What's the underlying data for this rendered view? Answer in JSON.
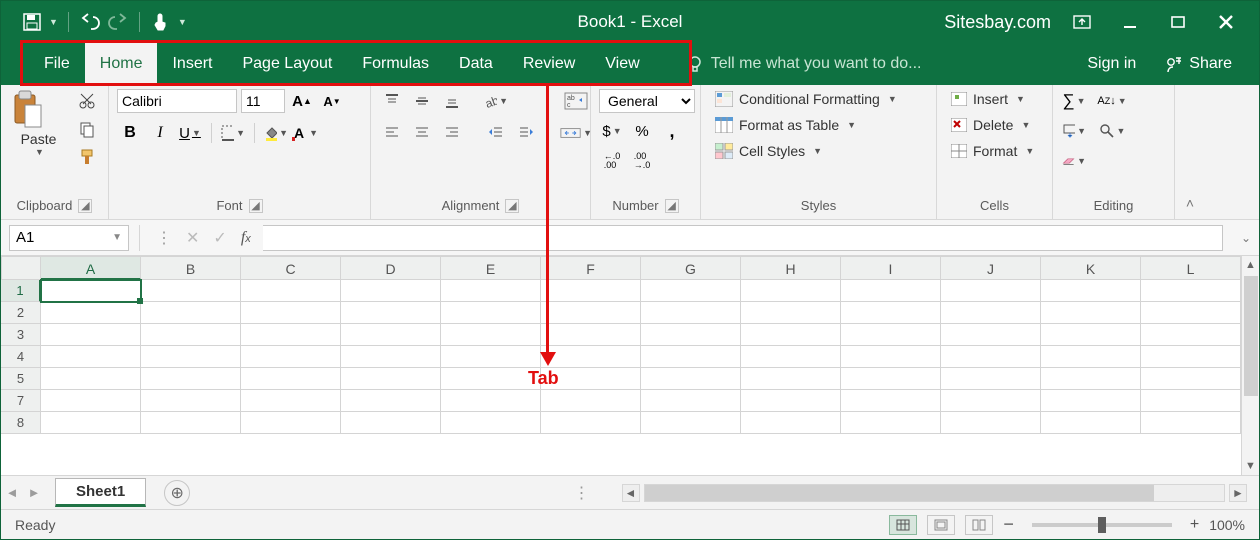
{
  "titlebar": {
    "title": "Book1 - Excel",
    "site": "Sitesbay.com"
  },
  "tabs": {
    "items": [
      "File",
      "Home",
      "Insert",
      "Page Layout",
      "Formulas",
      "Data",
      "Review",
      "View"
    ],
    "active": "Home",
    "tellme_placeholder": "Tell me what you want to do...",
    "signin": "Sign in",
    "share": "Share"
  },
  "ribbon": {
    "clipboard": {
      "label": "Clipboard",
      "paste": "Paste"
    },
    "font": {
      "label": "Font",
      "name": "Calibri",
      "size": "11",
      "bold": "B",
      "italic": "I",
      "underline": "U"
    },
    "alignment": {
      "label": "Alignment"
    },
    "number": {
      "label": "Number",
      "format": "General",
      "inc": ".0\n.00",
      "dec": ".00\n.0"
    },
    "styles": {
      "label": "Styles",
      "conditional": "Conditional Formatting",
      "table": "Format as Table",
      "cell": "Cell Styles"
    },
    "cells": {
      "label": "Cells",
      "insert": "Insert",
      "delete": "Delete",
      "format": "Format"
    },
    "editing": {
      "label": "Editing"
    }
  },
  "formulabar": {
    "namebox": "A1"
  },
  "grid": {
    "columns": [
      "A",
      "B",
      "C",
      "D",
      "E",
      "F",
      "G",
      "H",
      "I",
      "J",
      "K",
      "L"
    ],
    "rows": [
      "1",
      "2",
      "3",
      "4",
      "5",
      "7",
      "8"
    ],
    "selected_cell": "A1"
  },
  "sheettabs": {
    "active": "Sheet1"
  },
  "statusbar": {
    "ready": "Ready",
    "zoom": "100%"
  },
  "annotation": {
    "label": "Tab"
  }
}
